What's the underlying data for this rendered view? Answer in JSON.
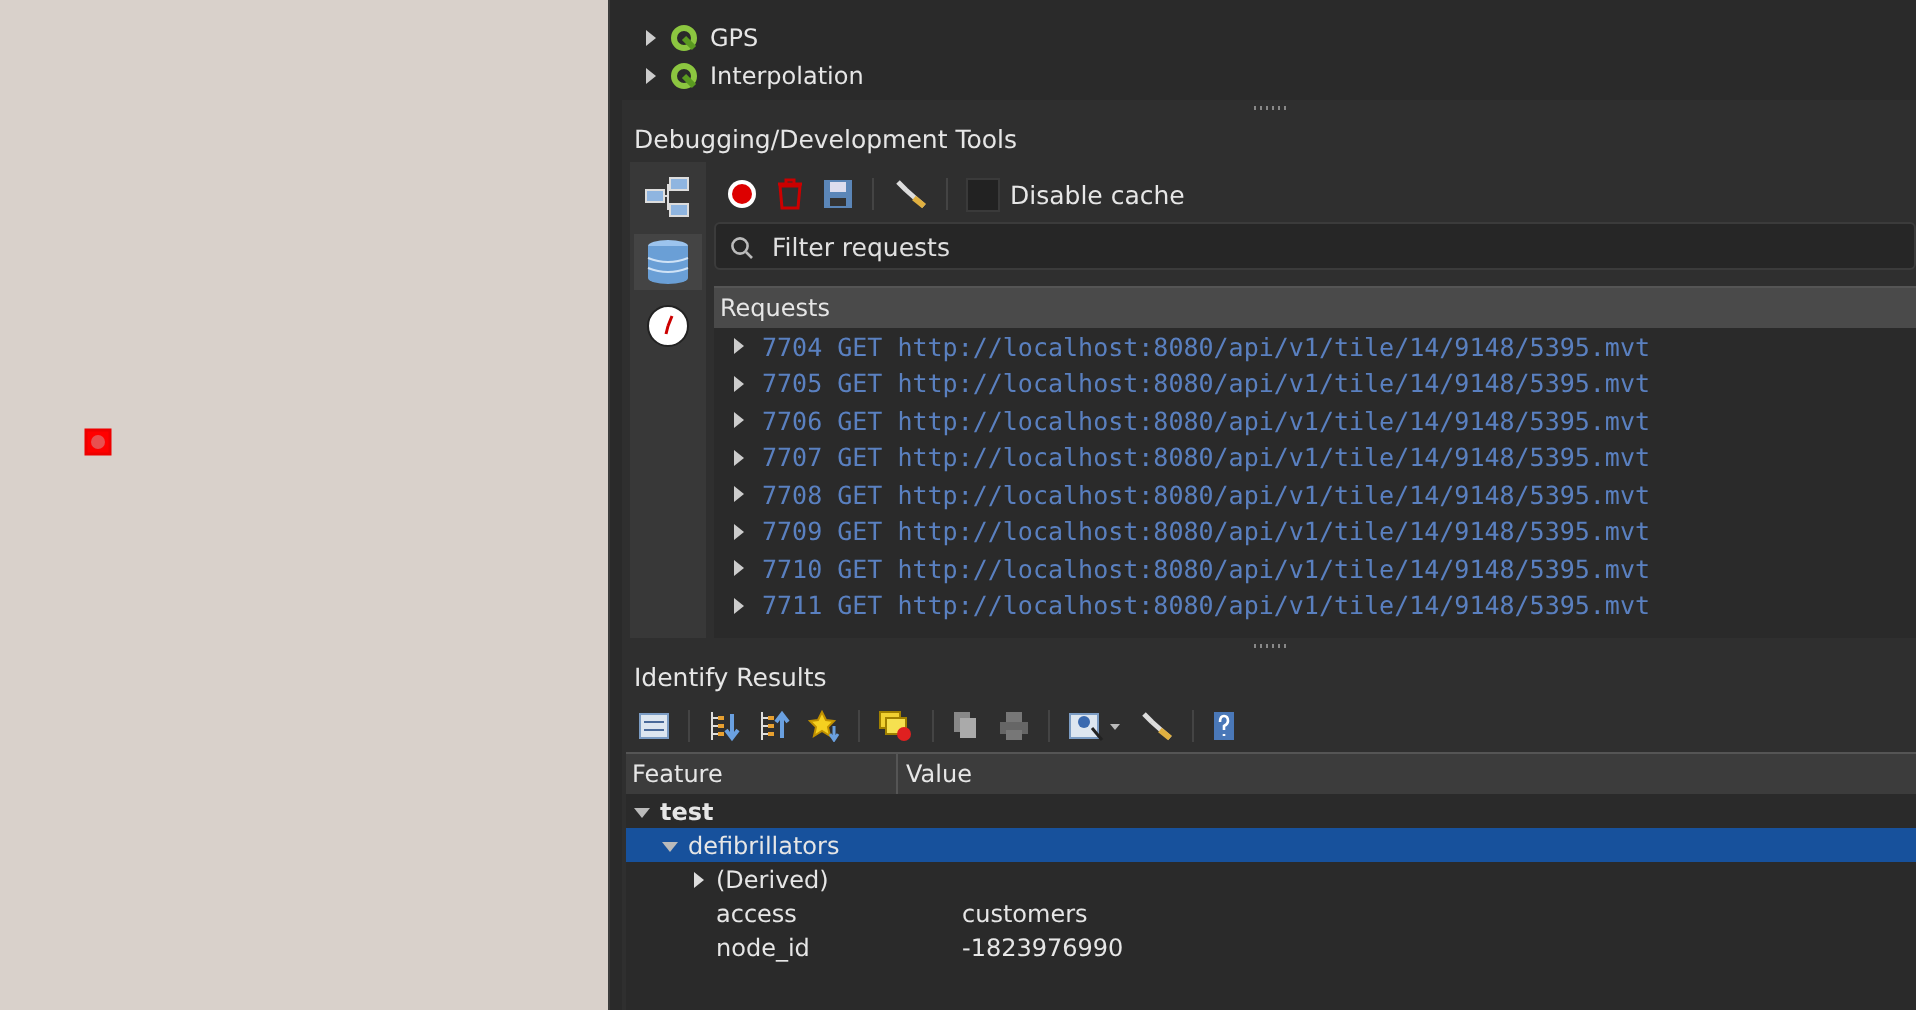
{
  "processing_tree": {
    "items": [
      {
        "label": "GPS",
        "expanded": false
      },
      {
        "label": "Interpolation",
        "expanded": false
      }
    ]
  },
  "debug_panel": {
    "title": "Debugging/Development Tools",
    "sidebar": [
      {
        "kind": "network",
        "selected": false
      },
      {
        "kind": "database",
        "selected": true
      },
      {
        "kind": "clock",
        "selected": false
      }
    ],
    "disable_cache": {
      "label": "Disable cache",
      "checked": false
    },
    "filter": {
      "placeholder": "Filter requests"
    },
    "requests": {
      "header": "Requests",
      "rows": [
        {
          "text": "7704 GET http://localhost:8080/api/v1/tile/14/9148/5395.mvt",
          "expanded": false
        },
        {
          "text": "7705 GET http://localhost:8080/api/v1/tile/14/9148/5395.mvt",
          "expanded": false
        },
        {
          "text": "7706 GET http://localhost:8080/api/v1/tile/14/9148/5395.mvt",
          "expanded": false
        },
        {
          "text": "7707 GET http://localhost:8080/api/v1/tile/14/9148/5395.mvt",
          "expanded": false
        },
        {
          "text": "7708 GET http://localhost:8080/api/v1/tile/14/9148/5395.mvt",
          "expanded": false
        },
        {
          "text": "7709 GET http://localhost:8080/api/v1/tile/14/9148/5395.mvt",
          "expanded": false
        },
        {
          "text": "7710 GET http://localhost:8080/api/v1/tile/14/9148/5395.mvt",
          "expanded": false
        },
        {
          "text": "7711 GET http://localhost:8080/api/v1/tile/14/9148/5395.mvt",
          "expanded": false
        }
      ]
    }
  },
  "identify_results": {
    "title": "Identify Results",
    "columns": [
      "Feature",
      "Value"
    ],
    "tree": [
      {
        "feature": "test",
        "expanded": true,
        "selected": false,
        "children": [
          {
            "feature": "defibrillators",
            "expanded": true,
            "selected": true,
            "children": [
              {
                "feature": "(Derived)",
                "expanded": false,
                "selected": false
              },
              {
                "feature": "access",
                "value": "customers",
                "selected": false
              },
              {
                "feature": "node_id",
                "value": "-1823976990",
                "selected": false
              }
            ]
          }
        ]
      }
    ]
  }
}
